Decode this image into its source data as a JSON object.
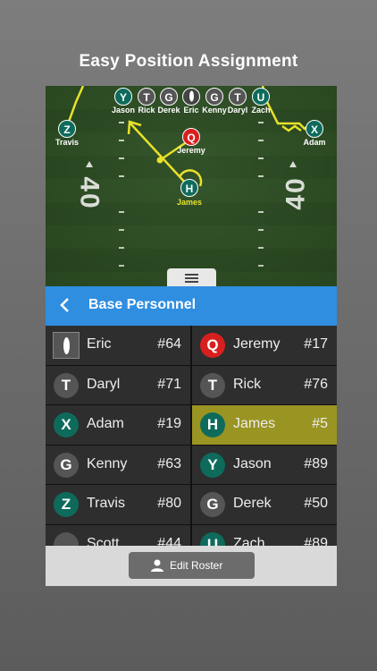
{
  "promo_title": "Easy Position Assignment",
  "field": {
    "yard_numbers": {
      "left": "40",
      "right": "40"
    },
    "top_row": [
      {
        "letter": "Y",
        "name": "Jason",
        "style": "teal"
      },
      {
        "letter": "T",
        "name": "Rick",
        "style": "gray"
      },
      {
        "letter": "G",
        "name": "Derek",
        "style": "gray"
      },
      {
        "letter": "",
        "name": "Eric",
        "style": "ball"
      },
      {
        "letter": "G",
        "name": "Kenny",
        "style": "gray"
      },
      {
        "letter": "T",
        "name": "Daryl",
        "style": "gray"
      },
      {
        "letter": "U",
        "name": "Zach",
        "style": "teal"
      }
    ],
    "others": [
      {
        "letter": "Z",
        "name": "Travis",
        "style": "teal"
      },
      {
        "letter": "X",
        "name": "Adam",
        "style": "teal"
      },
      {
        "letter": "Q",
        "name": "Jeremy",
        "style": "red"
      },
      {
        "letter": "H",
        "name": "James",
        "style": "teal"
      }
    ]
  },
  "header": {
    "title": "Base Personnel"
  },
  "roster": {
    "left": [
      {
        "letter": "",
        "name": "Eric",
        "number": "#64",
        "style": "ball"
      },
      {
        "letter": "T",
        "name": "Daryl",
        "number": "#71",
        "style": "gray"
      },
      {
        "letter": "X",
        "name": "Adam",
        "number": "#19",
        "style": "teal"
      },
      {
        "letter": "G",
        "name": "Kenny",
        "number": "#63",
        "style": "gray"
      },
      {
        "letter": "Z",
        "name": "Travis",
        "number": "#80",
        "style": "teal"
      },
      {
        "letter": "",
        "name": "Scott",
        "number": "#44",
        "style": "gray"
      }
    ],
    "right": [
      {
        "letter": "Q",
        "name": "Jeremy",
        "number": "#17",
        "style": "red",
        "selected": false
      },
      {
        "letter": "T",
        "name": "Rick",
        "number": "#76",
        "style": "gray",
        "selected": false
      },
      {
        "letter": "H",
        "name": "James",
        "number": "#5",
        "style": "teal",
        "selected": true
      },
      {
        "letter": "Y",
        "name": "Jason",
        "number": "#89",
        "style": "teal",
        "selected": false
      },
      {
        "letter": "G",
        "name": "Derek",
        "number": "#50",
        "style": "gray",
        "selected": false
      },
      {
        "letter": "U",
        "name": "Zach",
        "number": "#89",
        "style": "teal",
        "selected": false
      }
    ]
  },
  "footer": {
    "edit_label": "Edit Roster"
  },
  "colors": {
    "accent": "#2f8ee0",
    "selected_row": "#9a9422",
    "route": "#e9e12a",
    "teal": "#0e6b5c",
    "red": "#d81f1f"
  }
}
